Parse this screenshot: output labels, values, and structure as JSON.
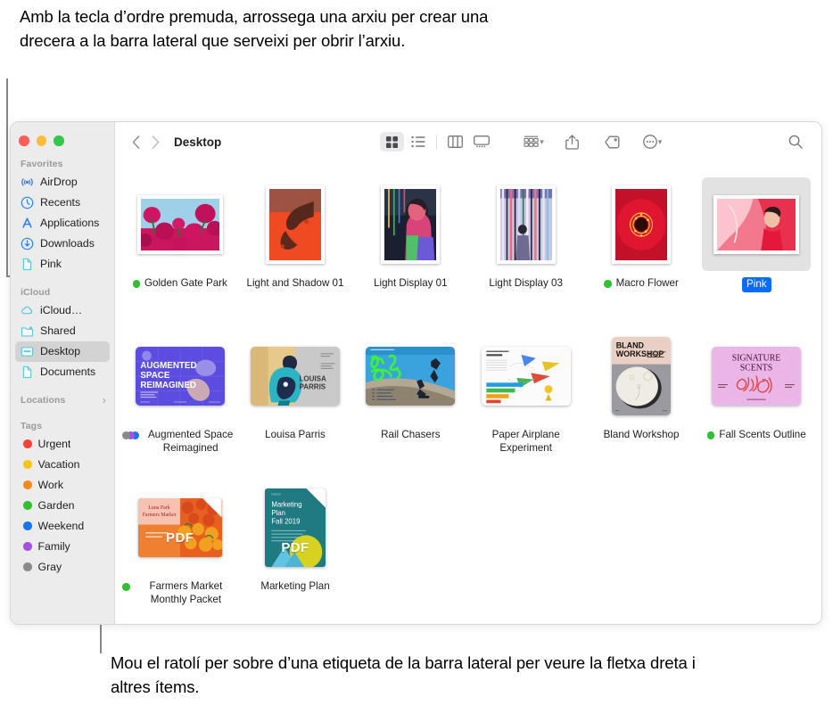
{
  "annotations": {
    "top": "Amb la tecla d’ordre premuda, arrossega una arxiu per crear una drecera a la barra lateral que serveixi per obrir l’arxiu.",
    "bottom": "Mou el ratolí per sobre d’una etiqueta de la barra lateral per veure la fletxa dreta i altres ítems."
  },
  "window": {
    "traffic_lights": [
      "close",
      "minimize",
      "zoom"
    ]
  },
  "toolbar": {
    "back_icon": "chevron-left-icon",
    "forward_icon": "chevron-right-icon",
    "title": "Desktop",
    "views": [
      {
        "name": "icon-view",
        "icon": "grid-icon",
        "active": true
      },
      {
        "name": "list-view",
        "icon": "list-icon",
        "active": false
      },
      {
        "name": "column-view",
        "icon": "columns-icon",
        "active": false
      },
      {
        "name": "gallery-view",
        "icon": "gallery-icon",
        "active": false
      }
    ],
    "actions": [
      {
        "name": "group-by",
        "icon": "group-icon",
        "has_chevron": true
      },
      {
        "name": "share",
        "icon": "share-icon",
        "has_chevron": false
      },
      {
        "name": "tag",
        "icon": "tag-icon",
        "has_chevron": false
      },
      {
        "name": "more",
        "icon": "ellipsis-circle-icon",
        "has_chevron": true
      }
    ],
    "search_icon": "search-icon"
  },
  "sidebar": {
    "sections": [
      {
        "title": "Favorites",
        "chevron": "",
        "items": [
          {
            "label": "AirDrop",
            "icon": "airdrop-icon",
            "selected": false
          },
          {
            "label": "Recents",
            "icon": "clock-icon",
            "selected": false
          },
          {
            "label": "Applications",
            "icon": "appstore-icon",
            "selected": false
          },
          {
            "label": "Downloads",
            "icon": "download-icon",
            "selected": false
          },
          {
            "label": "Pink",
            "icon": "document-icon",
            "selected": false
          }
        ]
      },
      {
        "title": "iCloud",
        "chevron": "",
        "items": [
          {
            "label": "iCloud…",
            "icon": "cloud-icon",
            "selected": false
          },
          {
            "label": "Shared",
            "icon": "shared-folder-icon",
            "selected": false
          },
          {
            "label": "Desktop",
            "icon": "desktop-icon",
            "selected": true
          },
          {
            "label": "Documents",
            "icon": "document-icon",
            "selected": false
          }
        ]
      },
      {
        "title": "Locations",
        "chevron": "›",
        "items": []
      },
      {
        "title": "Tags",
        "chevron": "",
        "items": [
          {
            "label": "Urgent",
            "icon": "tag-dot",
            "color": "#f9423a",
            "selected": false
          },
          {
            "label": "Vacation",
            "icon": "tag-dot",
            "color": "#f8c517",
            "selected": false
          },
          {
            "label": "Work",
            "icon": "tag-dot",
            "color": "#f7891e",
            "selected": false
          },
          {
            "label": "Garden",
            "icon": "tag-dot",
            "color": "#2fc12f",
            "selected": false
          },
          {
            "label": "Weekend",
            "icon": "tag-dot",
            "color": "#1675ef",
            "selected": false
          },
          {
            "label": "Family",
            "icon": "tag-dot",
            "color": "#a450e4",
            "selected": false
          },
          {
            "label": "Gray",
            "icon": "tag-dot",
            "color": "#8a8a8e",
            "selected": false
          }
        ]
      }
    ]
  },
  "files": [
    {
      "name": "Golden Gate Park",
      "tags": [
        "#2fc12f"
      ],
      "selected": false,
      "kind": "photo-landscape",
      "art": "golden-gate-park"
    },
    {
      "name": "Light and Shadow 01",
      "tags": [],
      "selected": false,
      "kind": "photo-portrait",
      "art": "light-and-shadow"
    },
    {
      "name": "Light Display 01",
      "tags": [],
      "selected": false,
      "kind": "photo-portrait",
      "art": "light-display-01"
    },
    {
      "name": "Light Display 03",
      "tags": [],
      "selected": false,
      "kind": "photo-portrait",
      "art": "light-display-03"
    },
    {
      "name": "Macro Flower",
      "tags": [
        "#2fc12f"
      ],
      "selected": false,
      "kind": "photo-portrait",
      "art": "macro-flower"
    },
    {
      "name": "Pink",
      "tags": [],
      "selected": true,
      "kind": "photo-landscape",
      "art": "pink"
    },
    {
      "name": "Augmented Space Reimagined",
      "tags": [
        "#8a8a8e",
        "#a450e4",
        "#1675ef"
      ],
      "selected": false,
      "kind": "doc-landscape",
      "art": "augmented-space"
    },
    {
      "name": "Louisa Parris",
      "tags": [],
      "selected": false,
      "kind": "doc-landscape",
      "art": "louisa-parris"
    },
    {
      "name": "Rail Chasers",
      "tags": [],
      "selected": false,
      "kind": "doc-landscape",
      "art": "rail-chasers"
    },
    {
      "name": "Paper Airplane Experiment",
      "tags": [],
      "selected": false,
      "kind": "doc-landscape",
      "art": "paper-airplane"
    },
    {
      "name": "Bland Workshop",
      "tags": [],
      "selected": false,
      "kind": "doc-portrait",
      "art": "bland-workshop"
    },
    {
      "name": "Fall Scents Outline",
      "tags": [
        "#2fc12f"
      ],
      "selected": false,
      "kind": "doc-landscape",
      "art": "signature-scents"
    },
    {
      "name": "Farmers Market Monthly Packet",
      "tags": [
        "#2fc12f"
      ],
      "selected": false,
      "kind": "pdf-landscape",
      "art": "farmers-market",
      "badge": "PDF"
    },
    {
      "name": "Marketing Plan",
      "tags": [],
      "selected": false,
      "kind": "pdf-portrait",
      "art": "marketing-plan",
      "badge": "PDF"
    }
  ],
  "artwork": {
    "golden-gate-park": {
      "title": ""
    },
    "bland-workshop": {
      "title": "BLAND WORKSHOP"
    },
    "signature-scents": {
      "title": "SIGNATURE SCENTS"
    },
    "augmented-space": {
      "title": "AUGMENTED SPACE REIMAGINED"
    },
    "louisa-parris": {
      "title": "LOUISA PARRIS"
    },
    "rail-chasers": {
      "title": "RAIL CHASERS"
    },
    "farmers-market": {
      "title": "Luna Park Farmers Market"
    },
    "marketing-plan": {
      "title": "Marketing Plan Fall 2019"
    }
  }
}
